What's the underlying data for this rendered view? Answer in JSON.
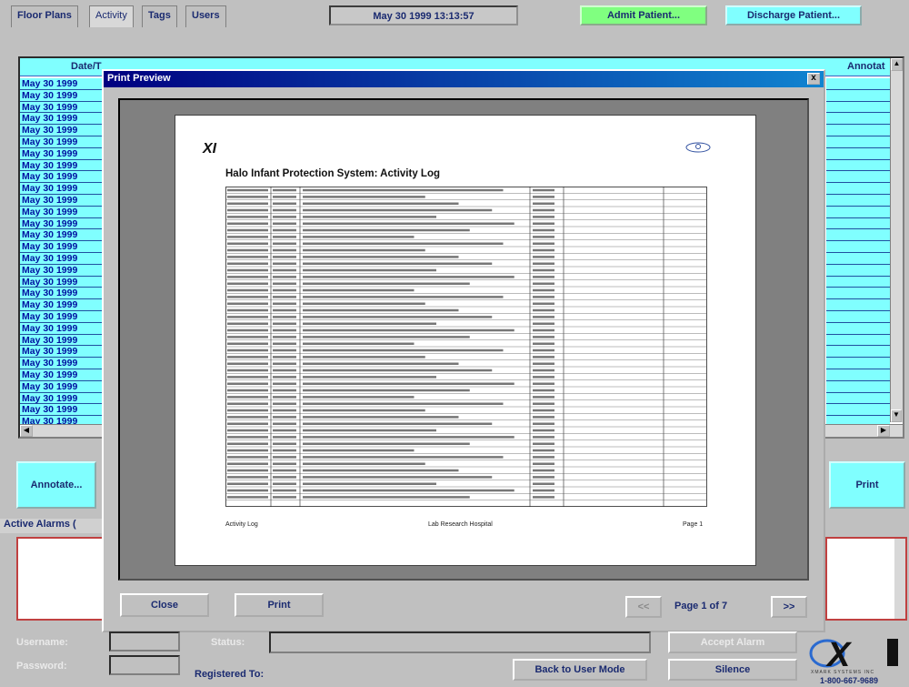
{
  "tabs": [
    "Floor Plans",
    "Activity",
    "Tags",
    "Users"
  ],
  "clock": "May 30 1999  13:13:57",
  "admit_label": "Admit Patient...",
  "discharge_label": "Discharge Patient...",
  "table": {
    "header_date": "Date/T",
    "header_annotation": "Annotat",
    "row_date": "May 30 1999",
    "row_count": 31
  },
  "annotate_label": "Annotate...",
  "print_label": "Print",
  "active_alarms_label": "Active Alarms (",
  "dialog": {
    "title": "Print Preview",
    "close_glyph": "x",
    "doc_title": "Halo Infant Protection System: Activity Log",
    "logo_text": "XI",
    "footer_left": "Activity Log",
    "footer_center": "Lab Research Hospital",
    "footer_right": "Page 1",
    "close_btn": "Close",
    "print_btn": "Print",
    "prev_btn": "<<",
    "page_indicator": "Page 1 of 7",
    "next_btn": ">>"
  },
  "bottom": {
    "username_label": "Username:",
    "password_label": "Password:",
    "status_label": "Status:",
    "registered_label": "Registered To:",
    "back_btn": "Back to User Mode",
    "accept_btn": "Accept Alarm",
    "silence_btn": "Silence",
    "phone": "1-800-667-9689",
    "brand_small": "XMARK SYSTEMS INC"
  },
  "colors": {
    "cyan": "#80ffff",
    "green": "#80ff80",
    "navy": "#000080"
  }
}
